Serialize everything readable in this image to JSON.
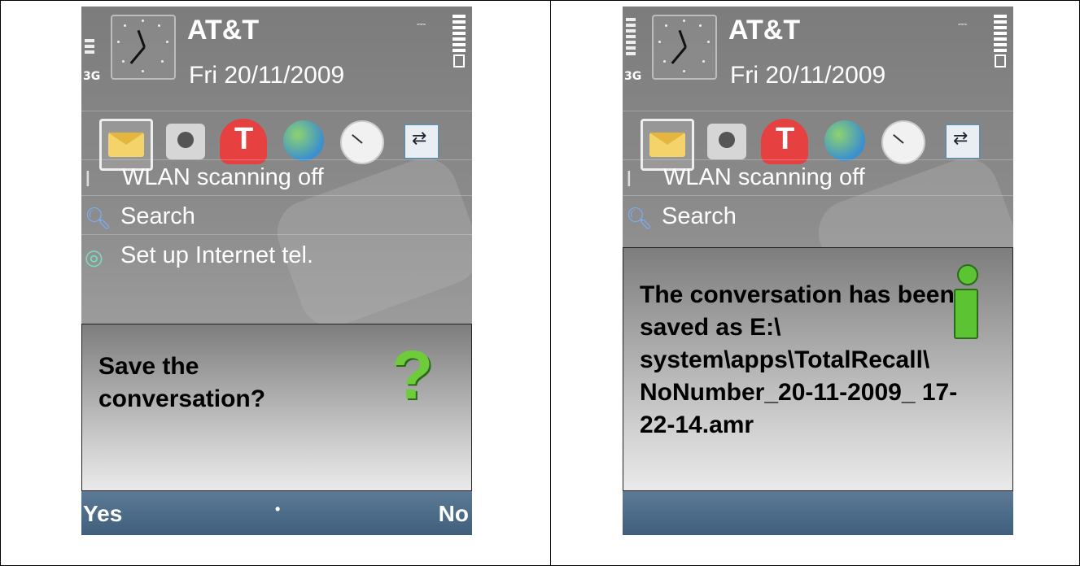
{
  "left_screen": {
    "status": {
      "operator": "AT&T",
      "date": "Fri 20/11/2009",
      "network": "3G"
    },
    "shortcuts": [
      {
        "icon": "message-icon",
        "selected": true
      },
      {
        "icon": "camera-icon"
      },
      {
        "icon": "operator-t-icon"
      },
      {
        "icon": "globe-icon"
      },
      {
        "icon": "clock-icon"
      },
      {
        "icon": "transfer-icon"
      }
    ],
    "list": [
      {
        "icon": "wlan-icon",
        "label": "WLAN scanning off"
      },
      {
        "icon": "search-icon",
        "label": "Search"
      },
      {
        "icon": "internet-tel-icon",
        "label": "Set up Internet tel."
      }
    ],
    "dialog": {
      "message": "Save the conversation?",
      "icon": "question-icon"
    },
    "softkeys": {
      "left": "Yes",
      "middle": "•",
      "right": "No"
    }
  },
  "right_screen": {
    "status": {
      "operator": "AT&T",
      "date": "Fri 20/11/2009",
      "network": "3G"
    },
    "list": [
      {
        "icon": "wlan-icon",
        "label": "WLAN scanning off"
      },
      {
        "icon": "search-icon",
        "label": "Search"
      }
    ],
    "dialog": {
      "message": "The conversation has been saved as E:\\ system\\apps\\TotalRecall\\ NoNumber_20-11-2009_ 17-22-14.amr",
      "icon": "info-icon"
    }
  }
}
